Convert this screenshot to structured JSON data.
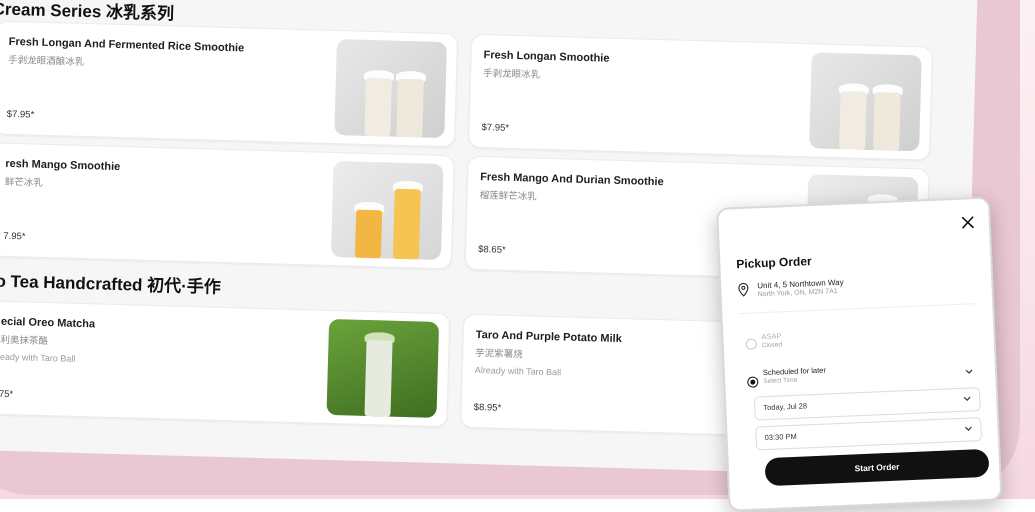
{
  "menu": {
    "sections": [
      {
        "title": "Cream Series 冰乳系列"
      },
      {
        "title": "oo Tea Handcrafted 初代·手作"
      }
    ],
    "items": [
      {
        "name": "Fresh Longan And Fermented Rice Smoothie",
        "cn": "手剥龙眼酒酿冰乳",
        "price": "$7.95*"
      },
      {
        "name": "Fresh Longan Smoothie",
        "cn": "手剥龙眼冰乳",
        "price": "$7.95*"
      },
      {
        "name": "resh Mango Smoothie",
        "cn": "鲜芒冰乳",
        "price": "7.95*"
      },
      {
        "name": "Fresh Mango And Durian Smoothie",
        "cn": "榴莲鲜芒冰乳",
        "price": "$8.65*"
      },
      {
        "name": "ecial Oreo Matcha",
        "cn": "利奥抹茶酪",
        "desc": "eady with Taro Ball",
        "price": "75*"
      },
      {
        "name": "Taro And Purple Potato Milk",
        "cn": "芋泥紫薯烧",
        "desc": "Already with Taro Ball",
        "price": "$8.95*"
      }
    ]
  },
  "modal": {
    "title": "Pickup Order",
    "address_line1": "Unit 4, 5 Northtown Way",
    "address_line2": "North York, ON, M2N 7A1",
    "asap_label": "ASAP",
    "asap_sub": "Closed",
    "scheduled_label": "Scheduled for later",
    "scheduled_sub": "Select Time",
    "date_value": "Today, Jul 28",
    "time_value": "03:30 PM",
    "start_button": "Start Order"
  },
  "icons": {
    "close": "close-icon",
    "pin": "location-pin-icon",
    "chevron": "chevron-down-icon"
  }
}
